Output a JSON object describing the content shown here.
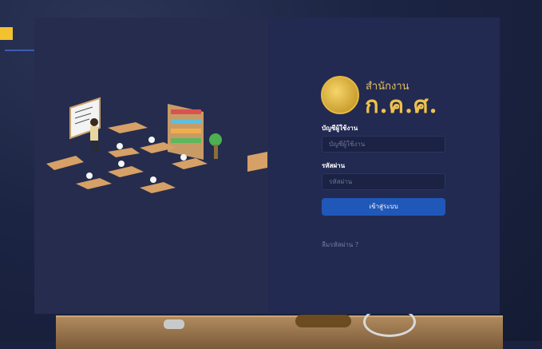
{
  "login": {
    "org_sub": "สำนักงาน",
    "org_name": "ก.ค.ศ.",
    "username_label": "บัญชีผู้ใช้งาน",
    "username_placeholder": "บัญชีผู้ใช้งาน",
    "password_label": "รหัสผ่าน",
    "password_placeholder": "รหัสผ่าน",
    "login_button": "เข้าสู่ระบบ",
    "forgot_password": "ลืมรหัสผ่าน ?"
  },
  "colors": {
    "accent_button": "#1f58b8",
    "logo_gold": "#f0c24a",
    "panel": "#222a52"
  }
}
